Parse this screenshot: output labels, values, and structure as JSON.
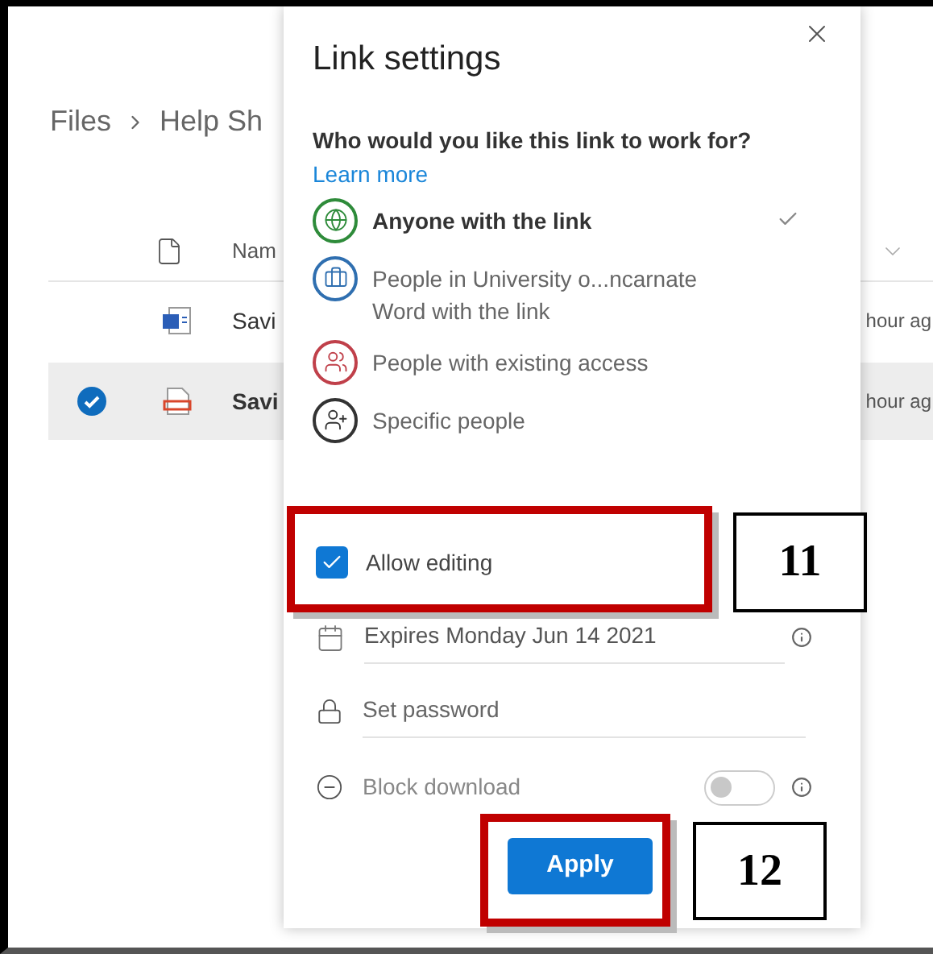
{
  "breadcrumb": [
    "Files",
    "Help Sh"
  ],
  "file_list": {
    "name_header": "Nam",
    "rows": [
      {
        "kind": "word",
        "name": "Savi",
        "modified": "hour ag",
        "selected": false
      },
      {
        "kind": "pdf",
        "name": "Savi",
        "modified": "hour ag",
        "selected": true
      }
    ]
  },
  "panel": {
    "title": "Link settings",
    "question": "Who would you like this link to work for?",
    "learn_more": "Learn more",
    "options": [
      {
        "kind": "globe",
        "label": "Anyone with the link",
        "selected": true
      },
      {
        "kind": "organization",
        "label": "People in University o...ncarnate Word with the link",
        "selected": false
      },
      {
        "kind": "existing",
        "label": "People with existing access",
        "selected": false
      },
      {
        "kind": "specific",
        "label": "Specific people",
        "selected": false
      }
    ],
    "allow_editing": {
      "label": "Allow editing",
      "checked": true
    },
    "expires": "Expires Monday Jun 14 2021",
    "password_placeholder": "Set password",
    "block_download": {
      "label": "Block download",
      "on": false
    },
    "apply": "Apply"
  },
  "annotations": [
    {
      "number": "11"
    },
    {
      "number": "12"
    }
  ]
}
